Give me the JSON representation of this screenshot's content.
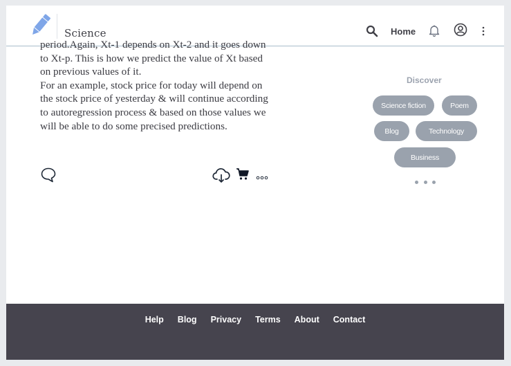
{
  "header": {
    "section_name": "Science",
    "home_label": "Home",
    "icons": [
      "pencil-logo-icon",
      "search-icon",
      "bell-icon",
      "user-circle-icon",
      "kebab-menu-icon"
    ]
  },
  "article": {
    "paragraph_1": "period.Again, Xt-1 depends on Xt-2 and it goes down to Xt-p. This is how we predict the value of Xt based on previous values of it.",
    "paragraph_2": "For an example, stock price for today will depend on the stock price of yesterday & will continue according to autoregression process & based on those values we will be able to do some precised predictions.",
    "actions": [
      "comment-icon",
      "download-icon",
      "cart-icon",
      "more-icon"
    ]
  },
  "discover": {
    "title": "Discover",
    "tags": [
      "Science fiction",
      "Poem",
      "Blog",
      "Technology",
      "Business"
    ]
  },
  "footer": {
    "links": [
      "Help",
      "Blog",
      "Privacy",
      "Terms",
      "About",
      "Contact"
    ]
  },
  "colors": {
    "page_background": "#e9ebee",
    "header_border": "#a7bccb",
    "logo_blue": "#7fa6e8",
    "pill": "#9aa2ad",
    "footer": "#46444e",
    "text": "#3b3b42"
  }
}
